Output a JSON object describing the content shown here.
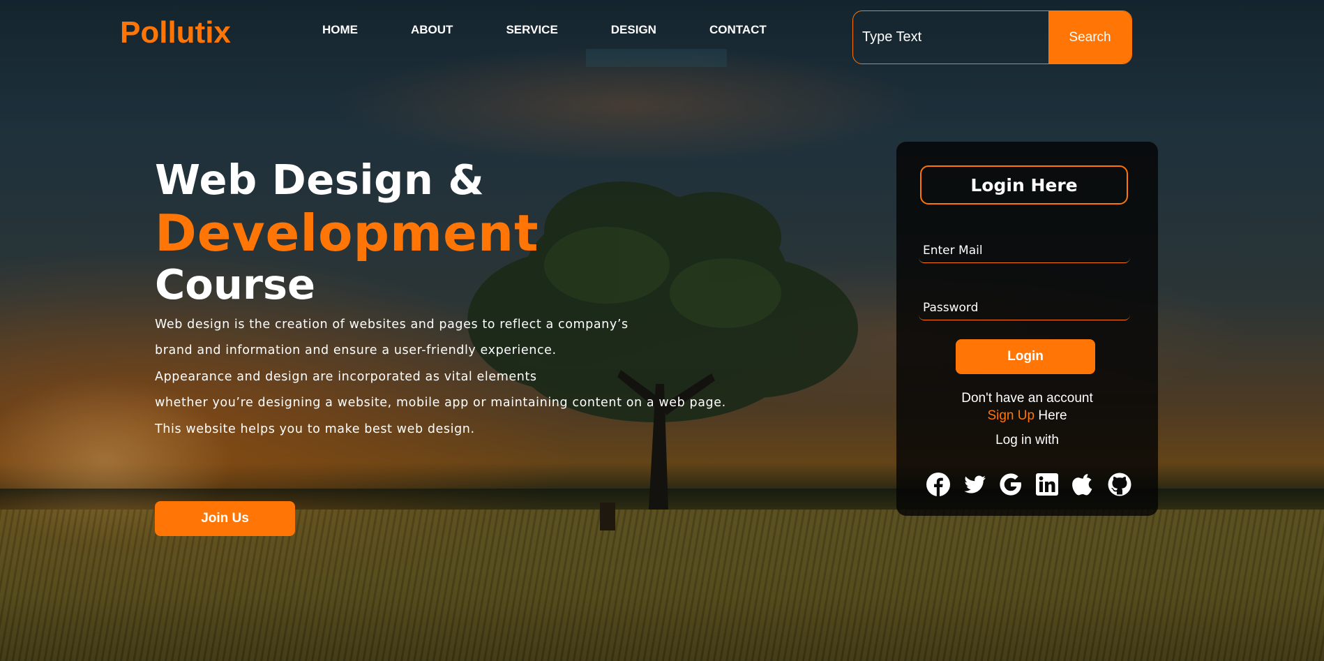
{
  "brand": {
    "logo_text": "Pollutix",
    "accent_color": "#ff7606"
  },
  "nav": {
    "items": [
      {
        "label": "HOME"
      },
      {
        "label": "ABOUT"
      },
      {
        "label": "SERVICE"
      },
      {
        "label": "DESIGN"
      },
      {
        "label": "CONTACT"
      }
    ]
  },
  "search": {
    "placeholder": "Type Text",
    "button_label": "Search"
  },
  "hero": {
    "title_line1": "Web Design &",
    "title_line2": "Development",
    "title_line3": "Course",
    "paragraphs": [
      "Web design is the creation of websites and pages to reflect a company’s",
      "brand and information and ensure a user-friendly experience.",
      "Appearance and design are incorporated as vital elements",
      "whether you’re designing a website, mobile app or maintaining content on a web page.",
      "This website helps you to make best web design."
    ],
    "cta_label": "Join Us"
  },
  "login": {
    "title": "Login Here",
    "email_placeholder": "Enter Mail",
    "password_placeholder": "Password",
    "submit_label": "Login",
    "no_account_text": "Don't have an account",
    "signup_link": "Sign Up",
    "signup_suffix": "Here",
    "social_heading": "Log in with",
    "social_icons": [
      "facebook-icon",
      "twitter-icon",
      "google-icon",
      "linkedin-icon",
      "apple-icon",
      "github-icon"
    ]
  }
}
